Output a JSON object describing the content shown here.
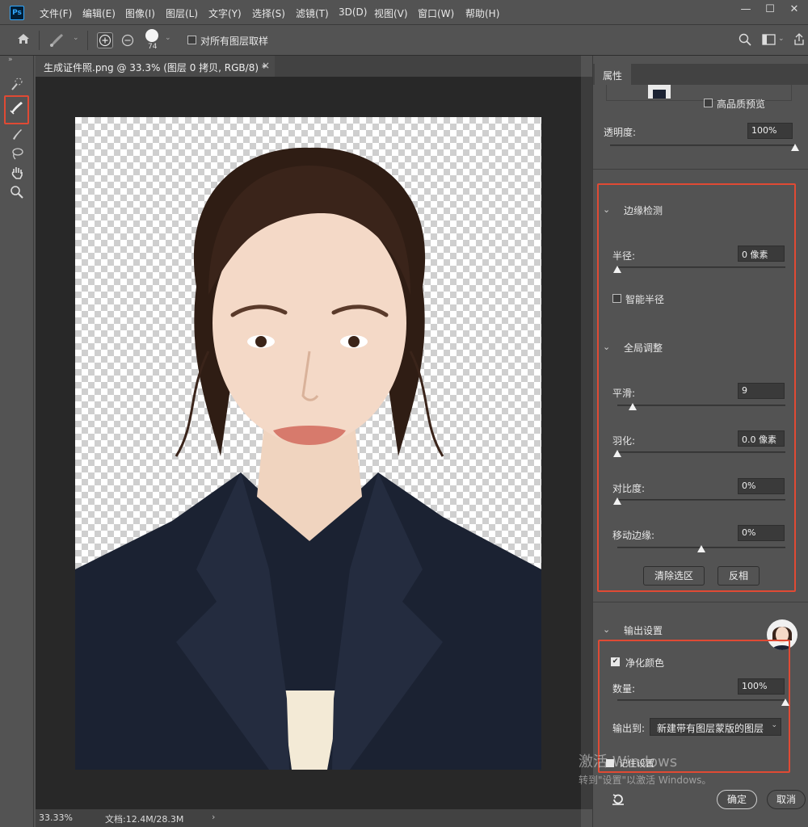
{
  "app": {
    "logo": "Ps"
  },
  "menu": [
    "文件(F)",
    "编辑(E)",
    "图像(I)",
    "图层(L)",
    "文字(Y)",
    "选择(S)",
    "滤镜(T)",
    "3D(D)",
    "视图(V)",
    "窗口(W)",
    "帮助(H)"
  ],
  "window_controls": {
    "minimize": "—",
    "maximize": "☐",
    "close": "✕"
  },
  "options": {
    "brush_size": "74",
    "sample_all_label": "对所有图层取样"
  },
  "document": {
    "tab_title": "生成证件照.png @ 33.3% (图层 0 拷贝, RGB/8) *",
    "tab_close": "×"
  },
  "status": {
    "zoom": "33.33%",
    "doc_info": "文档:12.4M/28.3M",
    "arrow": "›"
  },
  "panel": {
    "tab_label": "属性",
    "high_quality_label": "高品质预览",
    "opacity_label": "透明度:",
    "opacity_value": "100%",
    "opacity_level": 1.0,
    "edge_section": "边缘检测",
    "radius_label": "半径:",
    "radius_value": "0 像素",
    "radius_level": 0.0,
    "smart_radius_label": "智能半径",
    "global_section": "全局调整",
    "smooth_label": "平滑:",
    "smooth_value": "9",
    "smooth_level": 0.09,
    "feather_label": "羽化:",
    "feather_value": "0.0 像素",
    "feather_level": 0.0,
    "contrast_label": "对比度:",
    "contrast_value": "0%",
    "contrast_level": 0.0,
    "shift_label": "移动边缘:",
    "shift_value": "0%",
    "shift_level": 0.5,
    "clear_btn": "清除选区",
    "invert_btn": "反相",
    "output_section": "输出设置",
    "decontam_label": "净化颜色",
    "decontam_checked": "✔",
    "amount_label": "数量:",
    "amount_value": "100%",
    "amount_level": 1.0,
    "output_to_label": "输出到:",
    "output_to_value": "新建带有图层蒙版的图层",
    "remember_label": "记住设置",
    "ok_btn": "确定",
    "cancel_btn": "取消"
  },
  "watermark": {
    "line1": "激活 Windows",
    "line2": "转到\"设置\"以激活 Windows。"
  },
  "colors": {
    "highlight": "#e04a34",
    "accent": "#31a8ff"
  }
}
